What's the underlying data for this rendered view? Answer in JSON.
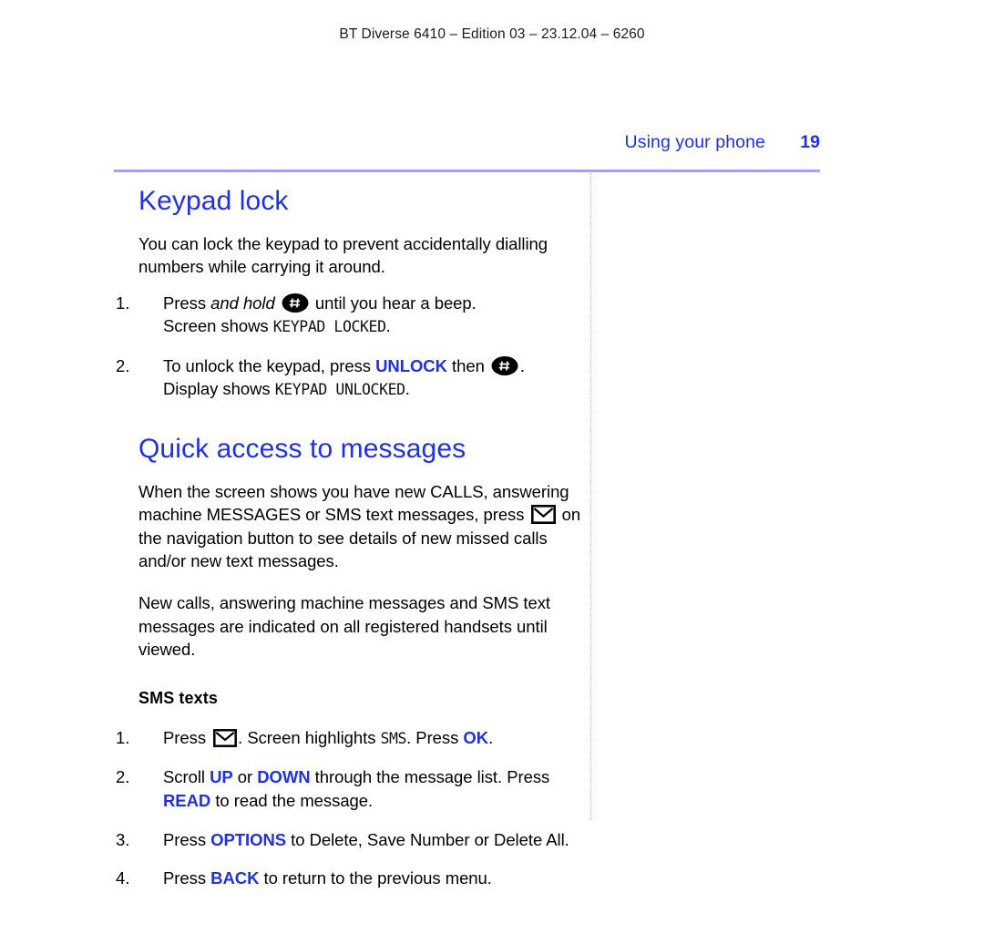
{
  "document": {
    "running_header": "BT Diverse 6410 – Edition 03 – 23.12.04 – 6260",
    "section_name": "Using your phone",
    "page_number": "19"
  },
  "colors": {
    "heading_blue": "#2030E8",
    "rule_blue": "#A3A3FB",
    "divider_blue": "#A9A9F2",
    "body_black": "#000000"
  },
  "icons": {
    "hash_key": "hash-key-icon",
    "envelope": "envelope-icon"
  },
  "sections": [
    {
      "title": "Keypad lock",
      "intro": "You can lock the keypad to prevent accidentally dialling numbers while carrying it around.",
      "steps": [
        {
          "number": "1.",
          "text_a": "Press ",
          "italic": "and hold",
          "text_b": " until you hear a beep.",
          "line2_a": "Screen shows ",
          "lcd": "KEYPAD LOCKED",
          "line2_b": "."
        },
        {
          "number": "2.",
          "text_a": "To unlock the keypad, press ",
          "key": "UNLOCK",
          "text_b": " then ",
          "text_c": ".",
          "line2_a": "Display shows ",
          "lcd": "KEYPAD UNLOCKED",
          "line2_b": "."
        }
      ]
    },
    {
      "title": "Quick access to messages",
      "paragraph_1_a": "When the screen shows you have new CALLS, answering machine MESSAGES or SMS text messages, press ",
      "paragraph_1_b": " on the navigation button to see details of new missed calls and/or new text messages.",
      "paragraph_2": "New calls, answering machine messages and SMS text messages are indicated on all registered handsets until viewed.",
      "subheading": "SMS texts",
      "steps": [
        {
          "number": "1.",
          "text_a": "Press ",
          "text_b": ". Screen highlights ",
          "lcd": "SMS",
          "text_c": ". Press ",
          "key": "OK",
          "text_d": "."
        },
        {
          "number": "2.",
          "text_a": "Scroll ",
          "key1": "UP",
          "text_b": " or ",
          "key2": "DOWN",
          "text_c": " through the message list. Press ",
          "key3": "READ",
          "text_d": " to read the message."
        },
        {
          "number": "3.",
          "text_a": "Press ",
          "key": "OPTIONS",
          "text_b": " to Delete, Save Number or Delete All."
        },
        {
          "number": "4.",
          "text_a": "Press ",
          "key": "BACK",
          "text_b": " to return to the previous menu."
        }
      ]
    }
  ]
}
